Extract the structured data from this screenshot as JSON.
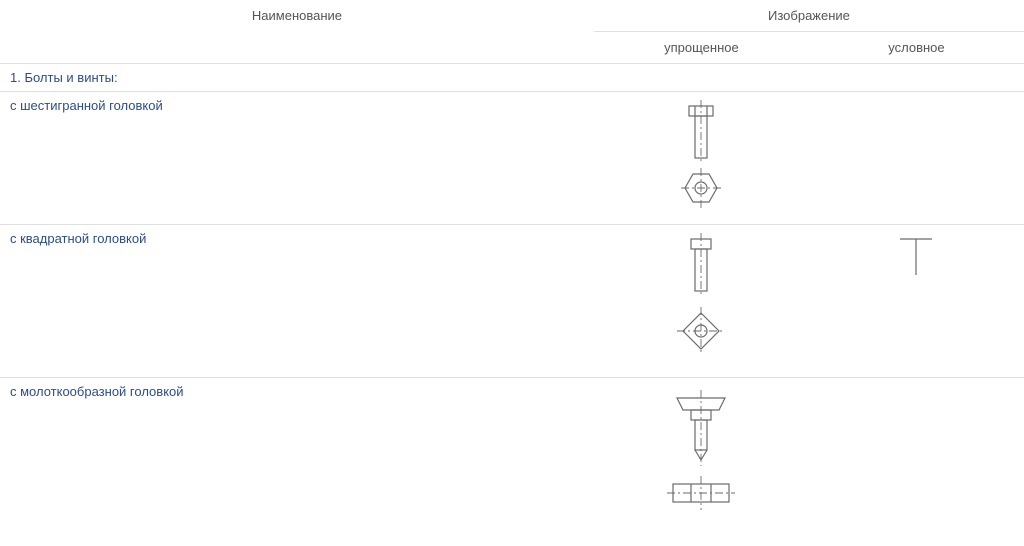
{
  "table": {
    "headers": {
      "name": "Наименование",
      "image": "Изображение",
      "simplified": "упрощенное",
      "conventional": "условное"
    },
    "section_title": "1. Болты и винты:",
    "rows": [
      {
        "name": "с шестигранной головкой",
        "simplified_icon": "bolt-hex",
        "conventional_icon": ""
      },
      {
        "name": "с квадратной головкой",
        "simplified_icon": "bolt-square",
        "conventional_icon": "tee"
      },
      {
        "name": "с молоткообразной головкой",
        "simplified_icon": "bolt-hammer",
        "conventional_icon": ""
      }
    ]
  }
}
